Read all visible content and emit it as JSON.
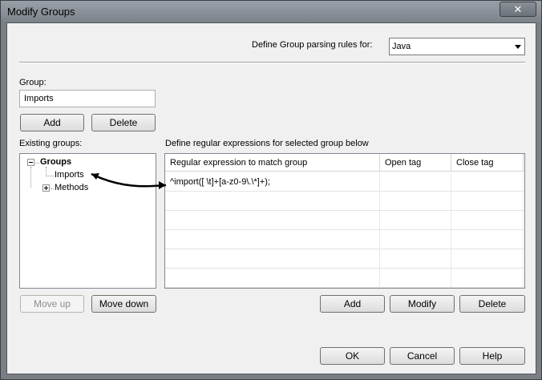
{
  "window": {
    "title": "Modify Groups",
    "close_glyph": "✕"
  },
  "language": {
    "label": "Define Group parsing rules for:",
    "selected": "Java"
  },
  "group": {
    "label": "Group:",
    "value": "Imports",
    "add_label": "Add",
    "delete_label": "Delete"
  },
  "existing": {
    "label": "Existing groups:",
    "tree": {
      "root": "Groups",
      "children": [
        "Imports",
        "Methods"
      ]
    },
    "move_up_label": "Move up",
    "move_down_label": "Move down"
  },
  "regex": {
    "label": "Define regular expressions for selected group below",
    "columns": [
      "Regular expression to match group",
      "Open tag",
      "Close tag"
    ],
    "rows": [
      [
        "^import([ \\t]+[a-z0-9\\.\\*]+);",
        "",
        ""
      ],
      [
        "",
        "",
        ""
      ],
      [
        "",
        "",
        ""
      ],
      [
        "",
        "",
        ""
      ],
      [
        "",
        "",
        ""
      ],
      [
        "",
        "",
        ""
      ]
    ],
    "add_label": "Add",
    "modify_label": "Modify",
    "delete_label": "Delete"
  },
  "footer": {
    "ok_label": "OK",
    "cancel_label": "Cancel",
    "help_label": "Help"
  },
  "colors": {
    "window_frame": "#7a7f86",
    "client_bg": "#f0f0f0",
    "arrow": "#000000"
  }
}
